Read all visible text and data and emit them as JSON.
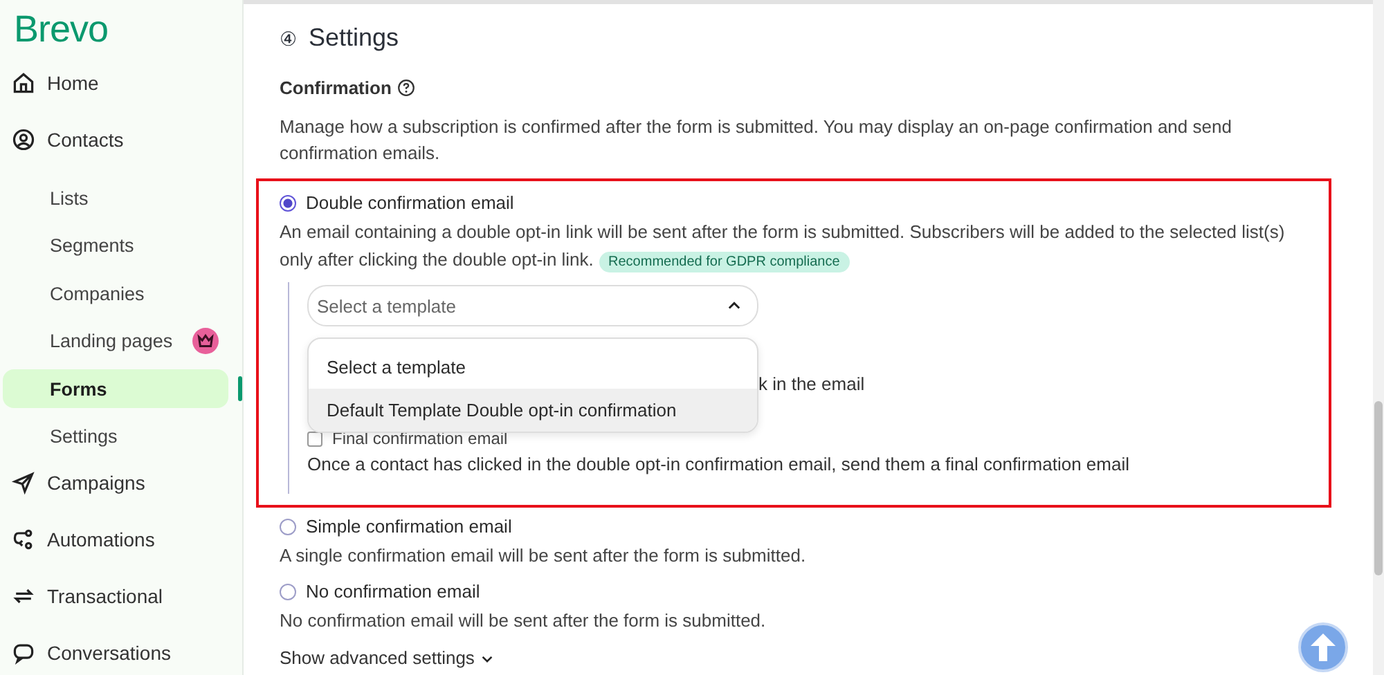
{
  "brand": "Brevo",
  "sidebar": {
    "items": [
      {
        "label": "Home"
      },
      {
        "label": "Contacts",
        "children": [
          {
            "label": "Lists",
            "selected": false,
            "premium": false
          },
          {
            "label": "Segments",
            "selected": false,
            "premium": false
          },
          {
            "label": "Companies",
            "selected": false,
            "premium": false
          },
          {
            "label": "Landing pages",
            "selected": false,
            "premium": true
          },
          {
            "label": "Forms",
            "selected": true,
            "premium": false
          },
          {
            "label": "Settings",
            "selected": false,
            "premium": false
          }
        ]
      },
      {
        "label": "Campaigns"
      },
      {
        "label": "Automations"
      },
      {
        "label": "Transactional"
      },
      {
        "label": "Conversations"
      }
    ]
  },
  "section": {
    "step": "④",
    "title": "Settings",
    "subtitle": "Confirmation",
    "description": "Manage how a subscription is confirmed after the form is submitted. You may display an on-page confirmation and send confirmation emails."
  },
  "options": [
    {
      "label": "Double confirmation email",
      "selected": true,
      "description": "An email containing a double opt-in link will be sent after the form is submitted. Subscribers will be added to the selected list(s) only after clicking the double opt-in link.",
      "badge": "Recommended for GDPR compliance",
      "template": {
        "placeholder": "Select a template",
        "expanded": true,
        "menu": [
          {
            "label": "Select a template",
            "selected": false
          },
          {
            "label": "Default Template Double opt-in confirmation",
            "selected": true
          }
        ]
      },
      "covered_text": "k in the email",
      "final": {
        "label": "Final confirmation email",
        "checked": false,
        "description": "Once a contact has clicked in the double opt-in confirmation email, send them a final confirmation email"
      }
    },
    {
      "label": "Simple confirmation email",
      "selected": false,
      "description": "A single confirmation email will be sent after the form is submitted."
    },
    {
      "label": "No confirmation email",
      "selected": false,
      "description": "No confirmation email will be sent after the form is submitted."
    }
  ],
  "advanced": "Show advanced settings"
}
